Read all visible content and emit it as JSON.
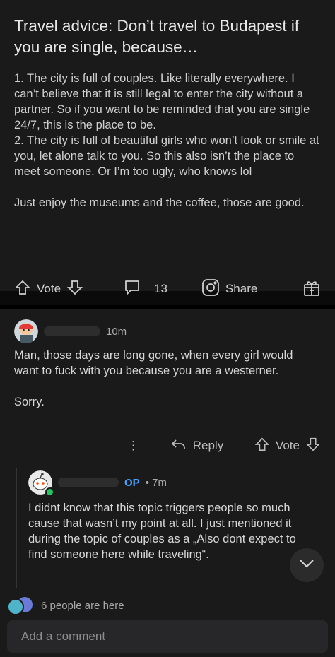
{
  "post": {
    "title": "Travel advice: Don’t travel to Budapest if you are single, because…",
    "paragraph1": "1. The city is full of couples. Like literally everywhere. I can’t believe that it is still legal to enter the city without a partner. So if you want to be reminded that you are single 24/7, this is the place to be.",
    "paragraph2": "2. The city is full of beautiful girls who won’t look or smile at you, let alone talk to you. So this also isn’t the place to meet someone. Or I’m too ugly, who knows lol",
    "paragraph3": "Just enjoy the museums and the coffee, those are good.",
    "vote_label": "Vote",
    "comment_count": "13",
    "share_label": "Share"
  },
  "comment1": {
    "time": "10m",
    "text1": "Man, those days are long gone, when every girl would want to fuck with you because you are a westerner.",
    "text2": "Sorry.",
    "more_label": "⋮",
    "reply_label": "Reply",
    "vote_label": "Vote"
  },
  "comment2": {
    "op_badge": "OP",
    "time": "• 7m",
    "text": "I didnt know that this topic triggers people so much cause that wasn’t my point at all. I just mentioned it during the topic of couples as a „Also dont expect to find someone here while traveling“."
  },
  "presence": {
    "text": "6 people are here"
  },
  "composer": {
    "placeholder": "Add a comment"
  },
  "colors": {
    "background": "#1a1a1b",
    "op": "#4aa3ff",
    "online": "#22c55e"
  }
}
